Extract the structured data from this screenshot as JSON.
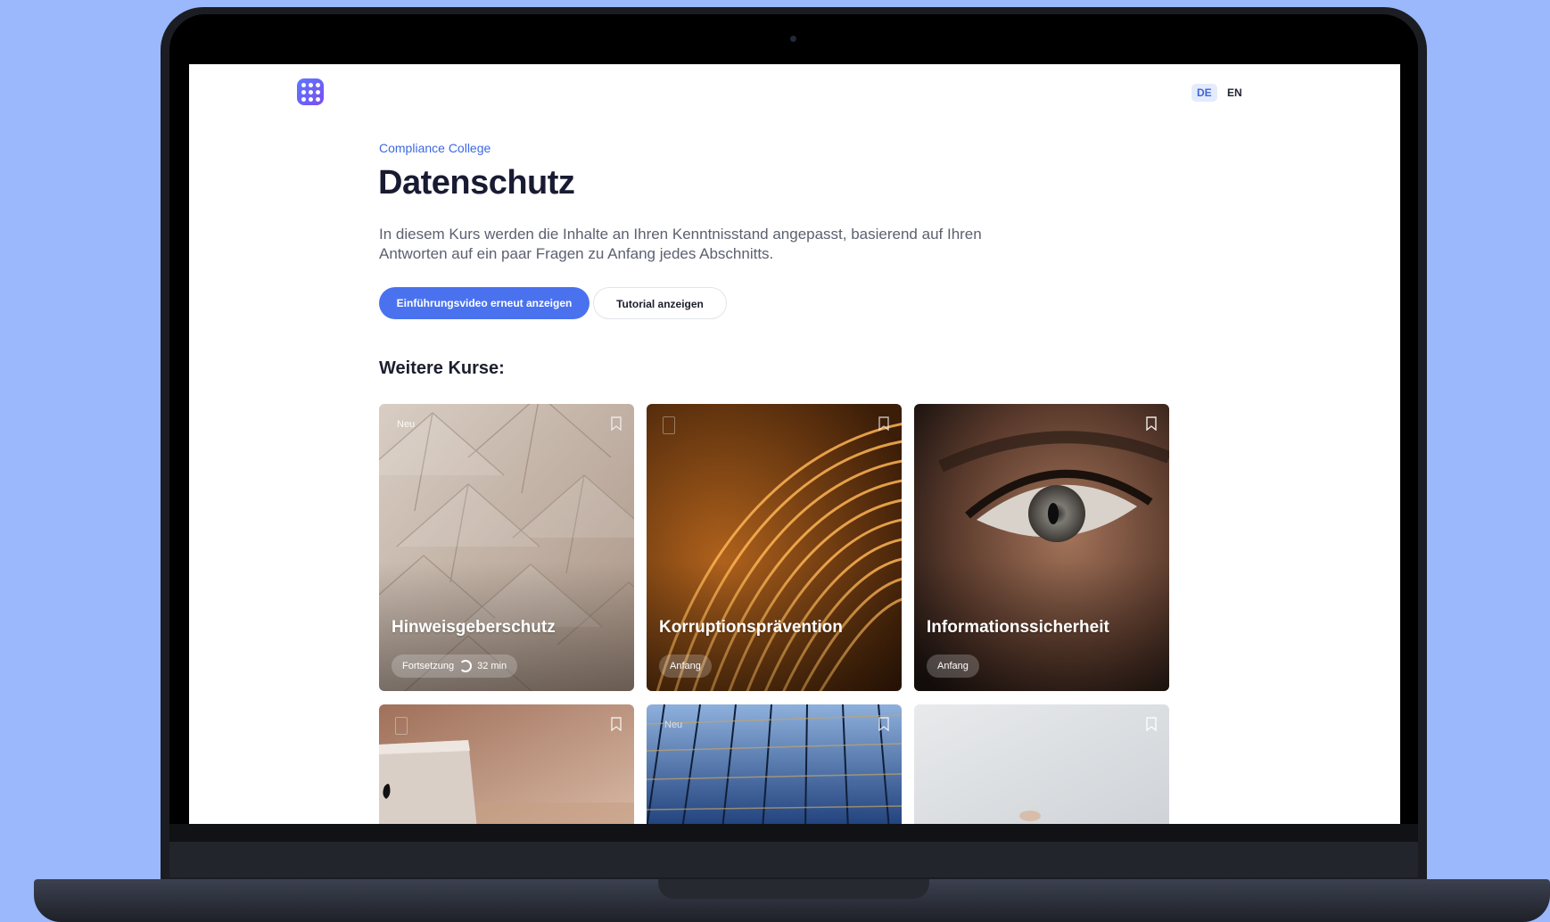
{
  "app": {
    "eyebrow": "Compliance College",
    "title": "Datenschutz",
    "description": "In diesem Kurs werden die Inhalte an Ihren Kenntnisstand angepasst, basierend auf Ihren Antworten auf ein paar Fragen zu Anfang jedes Abschnitts."
  },
  "header": {
    "languages": [
      "DE",
      "EN"
    ],
    "active_language": "DE"
  },
  "actions": {
    "primary_label": "Einführungsvideo erneut anzeigen",
    "secondary_label": "Tutorial anzeigen"
  },
  "section": {
    "title": "Weitere Kurse:"
  },
  "courses": [
    {
      "tag": "Neu",
      "title": "Hinweisgeberschutz",
      "status": "Fortsetzung",
      "duration": "32 min"
    },
    {
      "tag": "",
      "title": "Korruptionsprävention",
      "status": "Anfang"
    },
    {
      "tag": "",
      "title": "Informationssicherheit",
      "status": "Anfang"
    },
    {
      "tag": "",
      "title": ""
    },
    {
      "tag": "Neu",
      "title": ""
    },
    {
      "tag": "",
      "title": ""
    }
  ],
  "colors": {
    "background": "#9ab8fb",
    "accent": "#4a72ee",
    "eyebrow": "#3c68e2",
    "title": "#181b32"
  },
  "icons": {
    "logo": "grid-dots-logo-icon",
    "bookmark": "bookmark-icon",
    "progress": "progress-ring-icon"
  }
}
